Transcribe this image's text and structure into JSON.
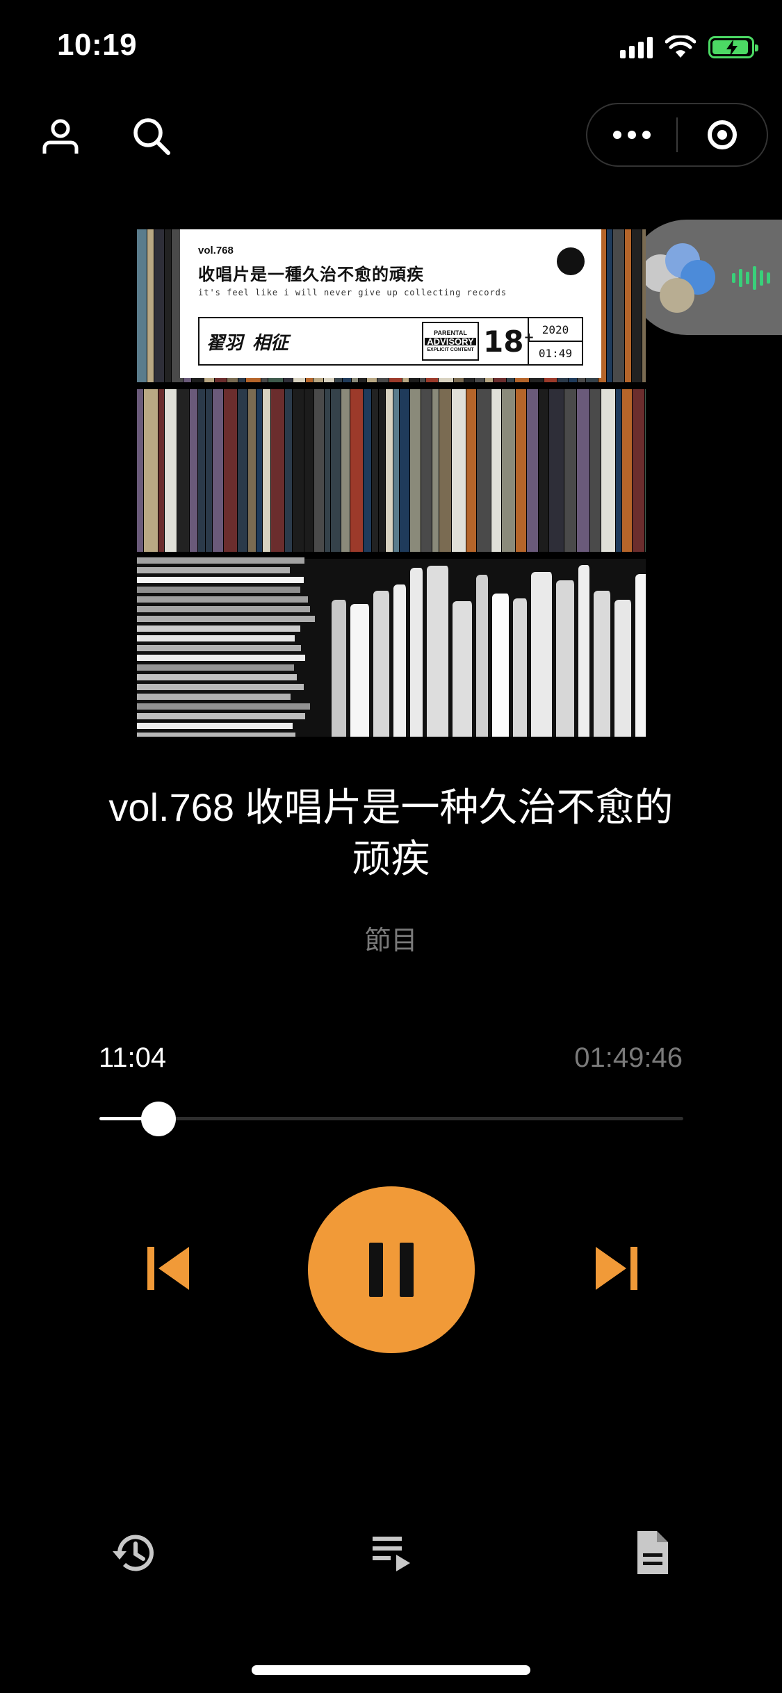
{
  "status_bar": {
    "time": "10:19"
  },
  "nav": {
    "profile_icon": "person-icon",
    "search_icon": "search-icon",
    "menu_icon": "more-dots-icon",
    "close_icon": "target-circle-icon"
  },
  "cover": {
    "vol": "vol.768",
    "title": "收唱片是一種久治不愈的頑疾",
    "subtitle_en": "it's feel like i will never give up collecting records",
    "signatures": [
      "翟羽",
      "相征"
    ],
    "advisory_top": "PARENTAL",
    "advisory_mid": "ADVISORY",
    "advisory_bottom": "EXPLICIT CONTENT",
    "age": "18",
    "age_plus": "+",
    "year": "2020",
    "duration": "01:49"
  },
  "episode": {
    "title": "vol.768 收唱片是一种久治不愈的顽疾",
    "category": "節目"
  },
  "progress": {
    "elapsed": "11:04",
    "total": "01:49:46",
    "fraction": 0.101
  },
  "controls": {
    "prev_icon": "skip-previous-icon",
    "play_state": "playing",
    "pause_icon": "pause-icon",
    "next_icon": "skip-next-icon"
  },
  "bottom_bar": {
    "history_icon": "history-icon",
    "playlist_icon": "playlist-icon",
    "document_icon": "document-icon"
  },
  "colors": {
    "accent": "#f19a38",
    "background": "#000000",
    "muted_text": "#7a7a7a",
    "battery": "#4cd964",
    "wave": "#39d07a"
  }
}
